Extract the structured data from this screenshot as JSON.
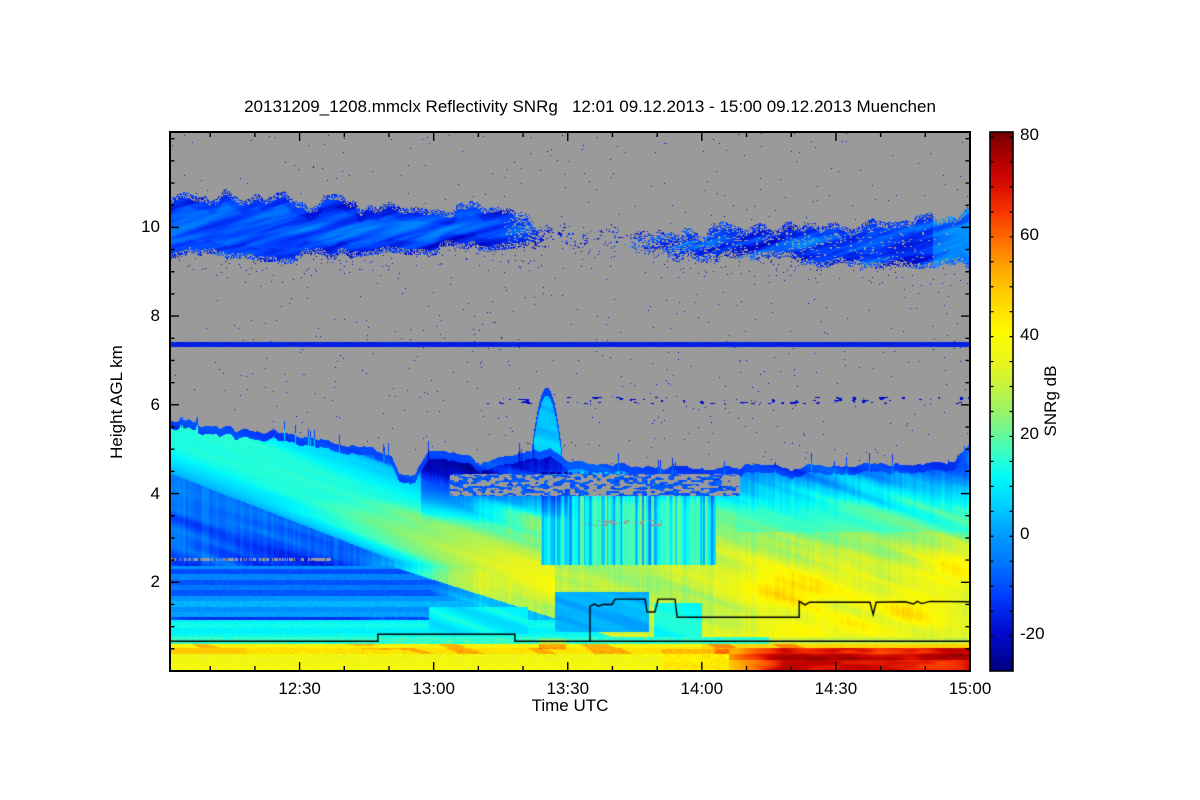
{
  "figure": {
    "title": "20131209_1208.mmclx Reflectivity SNRg   12:01 09.12.2013 - 15:00 09.12.2013 Muenchen"
  },
  "chart_data": {
    "type": "heatmap",
    "title": "20131209_1208.mmclx Reflectivity SNRg   12:01 09.12.2013 - 15:00 09.12.2013 Muenchen",
    "instrument_file": "20131209_1208.mmclx",
    "quantity": "Reflectivity SNRg",
    "time_start": "12:01 09.12.2013",
    "time_end": "15:00 09.12.2013",
    "station": "Muenchen",
    "xlabel": "Time UTC",
    "ylabel": "Height AGL km",
    "colorbar_label": "SNRg dB",
    "x_range_hours": [
      12.0167,
      15.0
    ],
    "x_major_ticks": [
      {
        "t": 12.5,
        "label": "12:30"
      },
      {
        "t": 13.0,
        "label": "13:00"
      },
      {
        "t": 13.5,
        "label": "13:30"
      },
      {
        "t": 14.0,
        "label": "14:00"
      },
      {
        "t": 14.5,
        "label": "14:30"
      },
      {
        "t": 15.0,
        "label": "15:00"
      }
    ],
    "x_minor_tick_minutes": 10,
    "y_range_km": [
      0,
      12.15
    ],
    "y_major_ticks": [
      2,
      4,
      6,
      8,
      10
    ],
    "y_minor_tick_km": 0.5,
    "value_range_db": [
      -28,
      80
    ],
    "colorbar_major_ticks": [
      80,
      60,
      40,
      20,
      0,
      -20
    ],
    "colorbar_minor_tick_db": 5,
    "no_signal_color": "#9a9a9a",
    "colormap_stops": [
      [
        -28,
        0,
        0,
        130
      ],
      [
        -20,
        0,
        10,
        205
      ],
      [
        -13,
        0,
        60,
        255
      ],
      [
        -6,
        0,
        120,
        255
      ],
      [
        0,
        0,
        160,
        255
      ],
      [
        6,
        0,
        215,
        255
      ],
      [
        11,
        0,
        250,
        250
      ],
      [
        16,
        60,
        255,
        195
      ],
      [
        21,
        120,
        245,
        135
      ],
      [
        27,
        180,
        242,
        80
      ],
      [
        33,
        228,
        245,
        35
      ],
      [
        40,
        255,
        250,
        0
      ],
      [
        47,
        255,
        210,
        0
      ],
      [
        53,
        255,
        165,
        0
      ],
      [
        59,
        255,
        105,
        0
      ],
      [
        65,
        245,
        45,
        0
      ],
      [
        71,
        205,
        5,
        0
      ],
      [
        76,
        165,
        0,
        0
      ],
      [
        80,
        115,
        0,
        0
      ]
    ],
    "features": {
      "cirrus_band": {
        "top_km": [
          [
            12.0,
            10.75
          ],
          [
            12.4,
            10.7
          ],
          [
            12.8,
            10.55
          ],
          [
            13.1,
            10.5
          ],
          [
            13.3,
            10.3
          ],
          [
            13.6,
            9.9
          ],
          [
            13.9,
            9.95
          ],
          [
            14.2,
            10.0
          ],
          [
            14.6,
            10.05
          ],
          [
            14.85,
            10.3
          ],
          [
            15.0,
            10.45
          ]
        ],
        "bottom_km": [
          [
            12.0,
            9.4
          ],
          [
            12.5,
            9.3
          ],
          [
            13.0,
            9.45
          ],
          [
            13.3,
            9.6
          ],
          [
            13.6,
            9.55
          ],
          [
            13.9,
            9.3
          ],
          [
            14.3,
            9.25
          ],
          [
            14.7,
            9.1
          ],
          [
            15.0,
            9.15
          ]
        ],
        "density": [
          [
            12.0,
            1
          ],
          [
            13.25,
            1
          ],
          [
            13.45,
            0.12
          ],
          [
            13.6,
            0.1
          ],
          [
            13.75,
            0.35
          ],
          [
            13.95,
            0.75
          ],
          [
            14.2,
            0.85
          ],
          [
            14.6,
            0.9
          ],
          [
            15.0,
            1
          ]
        ],
        "snr_db_range": [
          -26,
          -2
        ]
      },
      "isolated_line_km": 7.37,
      "isolated_line_snr_db": -17,
      "cloud_top_km": [
        [
          12.017,
          5.68
        ],
        [
          12.15,
          5.55
        ],
        [
          12.35,
          5.38
        ],
        [
          12.55,
          5.28
        ],
        [
          12.68,
          5.05
        ],
        [
          12.8,
          4.98
        ],
        [
          12.84,
          4.85
        ],
        [
          12.87,
          4.45
        ],
        [
          12.93,
          4.45
        ],
        [
          12.98,
          5.02
        ],
        [
          13.1,
          4.92
        ],
        [
          13.17,
          4.7
        ],
        [
          13.26,
          4.86
        ],
        [
          13.37,
          4.95
        ],
        [
          13.42,
          5.0
        ],
        [
          13.5,
          4.74
        ],
        [
          13.65,
          4.65
        ],
        [
          13.85,
          4.6
        ],
        [
          14.05,
          4.56
        ],
        [
          14.25,
          4.63
        ],
        [
          14.45,
          4.58
        ],
        [
          14.65,
          4.7
        ],
        [
          14.82,
          4.62
        ],
        [
          14.94,
          4.78
        ],
        [
          15.0,
          5.1
        ]
      ],
      "hook_plume": {
        "t_center": 13.42,
        "t_halfwidth": 0.055,
        "top_km": 6.4
      },
      "fall_streak_wedge": {
        "h_at_12h_km": 5.55,
        "slope_km_per_hour": -2.35,
        "t_end": 13.45,
        "width_km": 1.05
      },
      "layered_stripes": {
        "t_end": 12.85,
        "h_max_km": 2.38,
        "h_min_km": 0.77
      },
      "signal_gap_box": {
        "t": [
          13.04,
          14.16
        ],
        "h_km": [
          3.93,
          4.47
        ]
      },
      "value_profile_left_db": [
        [
          0,
          38
        ],
        [
          0.77,
          14
        ],
        [
          1.2,
          10
        ],
        [
          2.0,
          -8
        ],
        [
          2.38,
          -12
        ],
        [
          3.4,
          -9
        ],
        [
          4.2,
          -7
        ],
        [
          4.8,
          -6
        ],
        [
          5.3,
          -10
        ],
        [
          6.0,
          -14
        ]
      ],
      "value_profile_main_db": [
        [
          0,
          36
        ],
        [
          0.5,
          40
        ],
        [
          0.9,
          30
        ],
        [
          1.4,
          28
        ],
        [
          2.2,
          30
        ],
        [
          3.0,
          24
        ],
        [
          3.6,
          16
        ],
        [
          4.1,
          6
        ],
        [
          4.6,
          -6
        ],
        [
          5.2,
          -12
        ],
        [
          6.5,
          -14
        ]
      ],
      "orange_cells_t_h_st_sh_amp": [
        [
          14.33,
          1.8,
          0.22,
          0.5,
          16
        ],
        [
          14.77,
          1.35,
          0.18,
          0.45,
          14
        ],
        [
          14.92,
          2.3,
          0.12,
          0.5,
          12
        ],
        [
          14.42,
          0.95,
          0.2,
          0.3,
          12
        ]
      ],
      "blue_patches_t1_t2_h1_h2_db": [
        [
          12.98,
          13.35,
          0.85,
          1.45,
          4
        ],
        [
          13.45,
          13.8,
          0.9,
          1.8,
          -4
        ],
        [
          13.82,
          14.0,
          0.75,
          1.55,
          6
        ]
      ],
      "surface_bands": {
        "cyan_row_km": [
          0.62,
          0.77
        ],
        "yellow_row_km": [
          0.52,
          0.62
        ],
        "orange_streak_km": [
          0.4,
          0.52
        ],
        "lower_yellow_km": [
          0.0,
          0.4
        ]
      },
      "heavy_rain": {
        "t_start": 14.1,
        "h_max_km": 0.52,
        "snr_db_max": 78
      },
      "melting_layer_line_t_km": [
        [
          13.583,
          0.67
        ],
        [
          13.583,
          1.46
        ],
        [
          13.6,
          1.51
        ],
        [
          13.615,
          1.46
        ],
        [
          13.63,
          1.5
        ],
        [
          13.665,
          1.5
        ],
        [
          13.676,
          1.62
        ],
        [
          13.788,
          1.62
        ],
        [
          13.796,
          1.33
        ],
        [
          13.825,
          1.33
        ],
        [
          13.837,
          1.62
        ],
        [
          13.9,
          1.62
        ],
        [
          13.908,
          1.21
        ],
        [
          14.363,
          1.21
        ],
        [
          14.363,
          1.57
        ],
        [
          14.385,
          1.49
        ],
        [
          14.402,
          1.55
        ],
        [
          14.627,
          1.55
        ],
        [
          14.639,
          1.27
        ],
        [
          14.65,
          1.55
        ],
        [
          14.758,
          1.56
        ],
        [
          14.79,
          1.51
        ],
        [
          14.803,
          1.57
        ],
        [
          14.82,
          1.52
        ],
        [
          14.851,
          1.57
        ],
        [
          15.0,
          1.56
        ]
      ],
      "lowest_gate_line_t_km": [
        [
          12.017,
          0.67
        ],
        [
          12.792,
          0.67
        ],
        [
          12.792,
          0.83
        ],
        [
          13.303,
          0.83
        ],
        [
          13.303,
          0.67
        ],
        [
          15.0,
          0.67
        ]
      ]
    }
  }
}
